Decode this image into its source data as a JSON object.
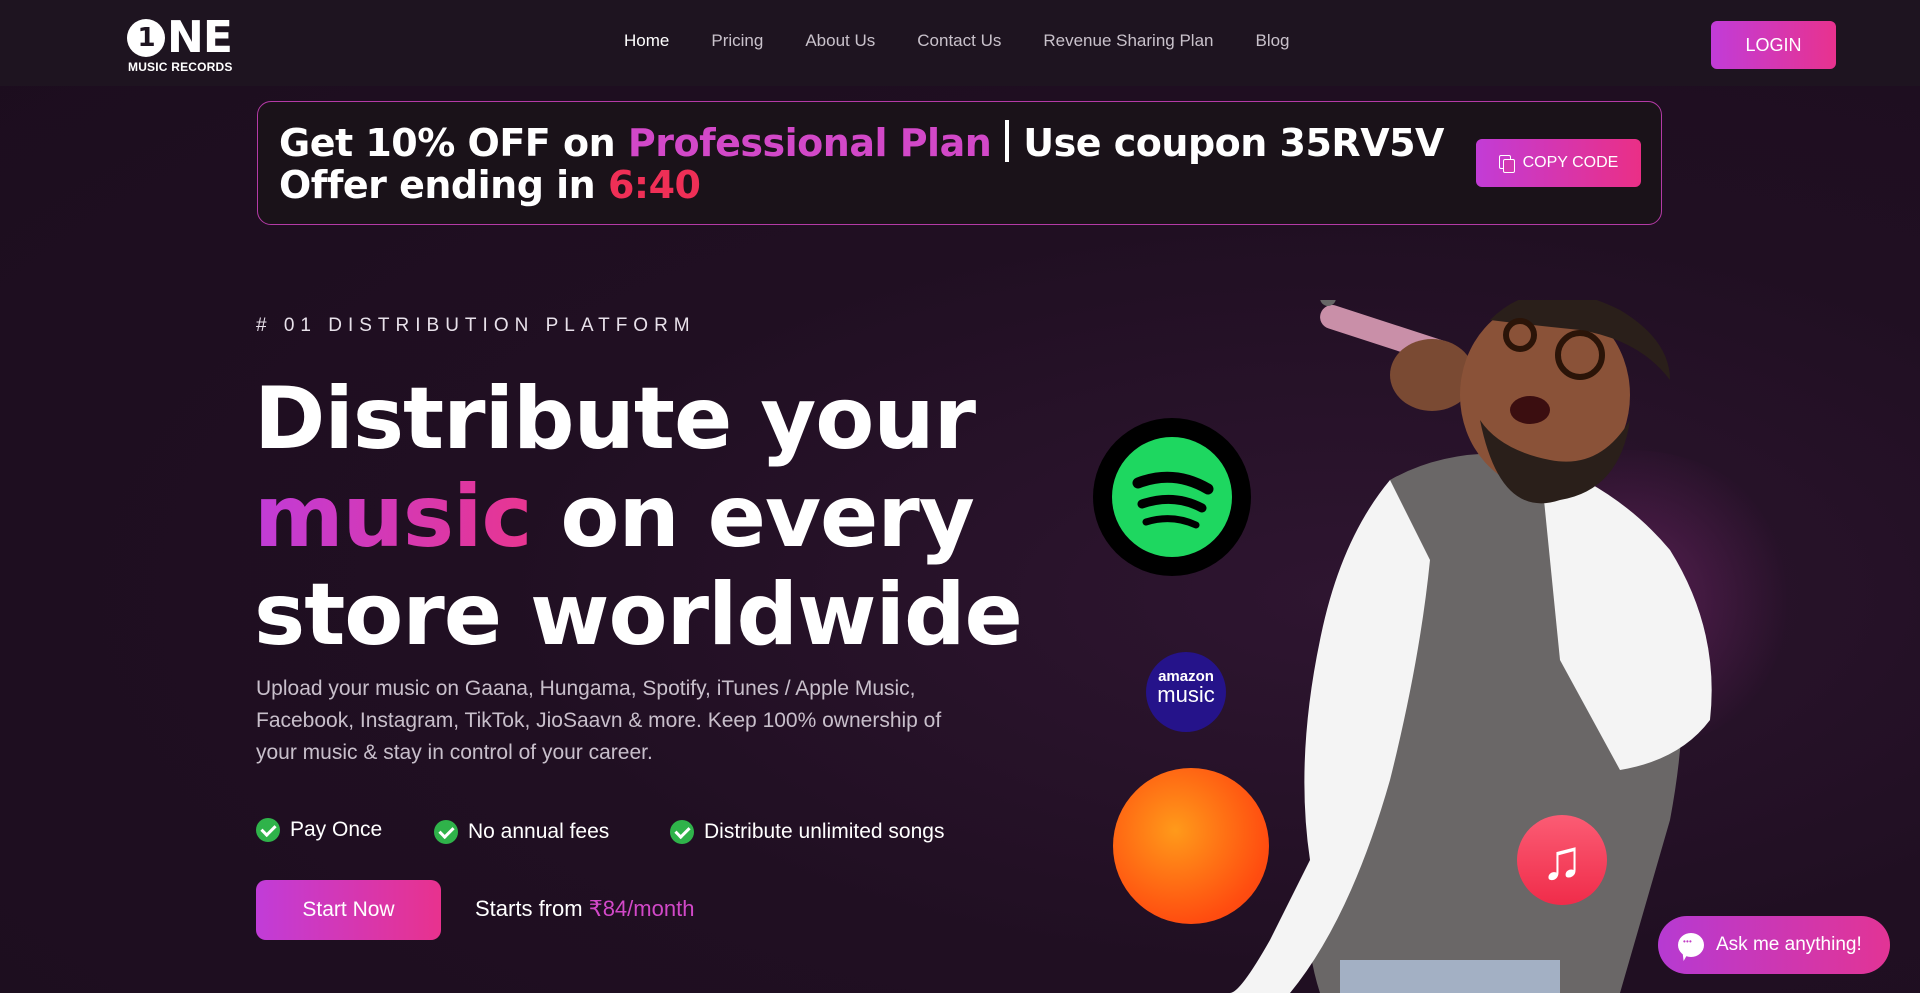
{
  "nav": {
    "logo_big": "ONE",
    "logo_one": "1",
    "logo_small": "MUSIC RECORDS",
    "links": [
      "Home",
      "Pricing",
      "About Us",
      "Contact Us",
      "Revenue Sharing Plan",
      "Blog"
    ],
    "active": "Home",
    "login_label": "LOGIN"
  },
  "promo": {
    "part1": "Get 10% OFF on",
    "plan": "Professional Plan",
    "part2": "Use coupon 35RV5V",
    "offer": "Offer ending in",
    "timer": "6:40",
    "copy_label": "COPY CODE"
  },
  "hero": {
    "tagline": "# 01 DISTRIBUTION PLATFORM",
    "headline_1": "Distribute your",
    "headline_pink": "music",
    "headline_2": " on every",
    "headline_3": "store worldwide",
    "description": "Upload your music on Gaana, Hungama, Spotify, iTunes / Apple Music, Facebook, Instagram, TikTok, JioSaavn & more. Keep 100% ownership of your music & stay in control of your career.",
    "features": [
      "Pay Once",
      "No annual fees",
      "Distribute unlimited songs"
    ],
    "start_label": "Start Now",
    "price_prefix": "Starts from",
    "price_value": "₹84/month"
  },
  "art": {
    "amazon_line1": "amazon",
    "amazon_line2": "music",
    "apple_glyph": "♫"
  },
  "chat": {
    "label": "Ask me anything!"
  },
  "colors": {
    "accent_purple": "#c13cd8",
    "accent_pink": "#e8328e",
    "timer_red": "#ef2f56",
    "background": "#200f22"
  }
}
